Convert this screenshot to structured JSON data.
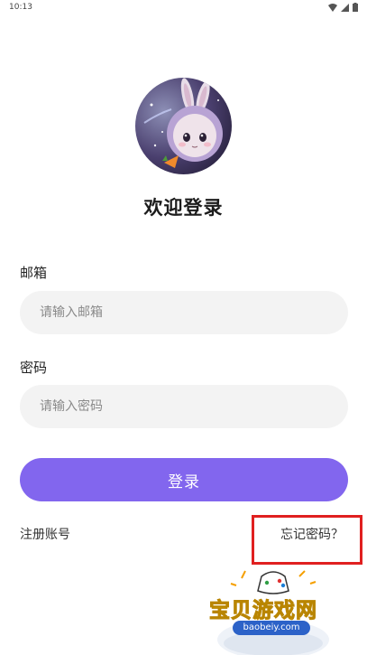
{
  "status_bar": {
    "time": "10:13",
    "icons": [
      "wifi-icon",
      "signal-icon",
      "battery-icon"
    ]
  },
  "header": {
    "avatar_icon": "bunny-avatar-icon",
    "title": "欢迎登录"
  },
  "form": {
    "email_label": "邮箱",
    "email_placeholder": "请输入邮箱",
    "password_label": "密码",
    "password_placeholder": "请输入密码",
    "login_label": "登录"
  },
  "links": {
    "register": "注册账号",
    "forgot_password": "忘记密码？"
  },
  "watermark": {
    "text": "宝贝游戏网",
    "url": "baobeiy.com"
  },
  "colors": {
    "accent": "#8266ee",
    "input_bg": "#f3f3f3",
    "highlight": "#e02020"
  }
}
